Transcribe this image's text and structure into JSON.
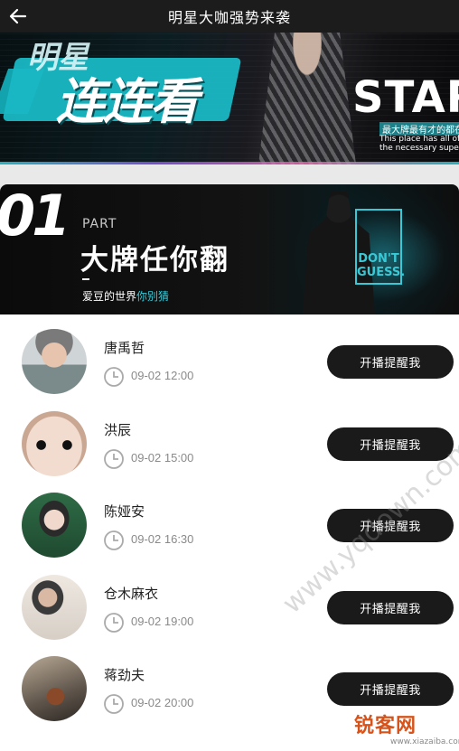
{
  "header": {
    "title": "明星大咖强势来袭"
  },
  "hero": {
    "small_text": "明星",
    "title": "连连看",
    "star": "STAR",
    "cn_line": "最大牌最有才的都在这里",
    "en_line1": "This place has all of",
    "en_line2": "the necessary superstar"
  },
  "part": {
    "number": "01",
    "label": "PART",
    "title": "大牌任你翻",
    "subtitle_prefix": "爱豆的世界",
    "subtitle_highlight": "你别猜",
    "poster_line1": "DON'T",
    "poster_line2": "GUESS."
  },
  "schedule": [
    {
      "name": "唐禹哲",
      "time": "09-02 12:00",
      "button": "开播提醒我"
    },
    {
      "name": "洪辰",
      "time": "09-02 15:00",
      "button": "开播提醒我"
    },
    {
      "name": "陈娅安",
      "time": "09-02 16:30",
      "button": "开播提醒我"
    },
    {
      "name": "仓木麻衣",
      "time": "09-02 19:00",
      "button": "开播提醒我"
    },
    {
      "name": "蒋劲夫",
      "time": "09-02 20:00",
      "button": "开播提醒我"
    }
  ],
  "watermark": {
    "text": "www.yqdown.com",
    "logo": "锐客网",
    "logo_url": "www.xiazaiba.com"
  },
  "colors": {
    "topbar": "#1c1c1c",
    "accent": "#38c7d4",
    "button_bg": "#1a1a1a"
  }
}
